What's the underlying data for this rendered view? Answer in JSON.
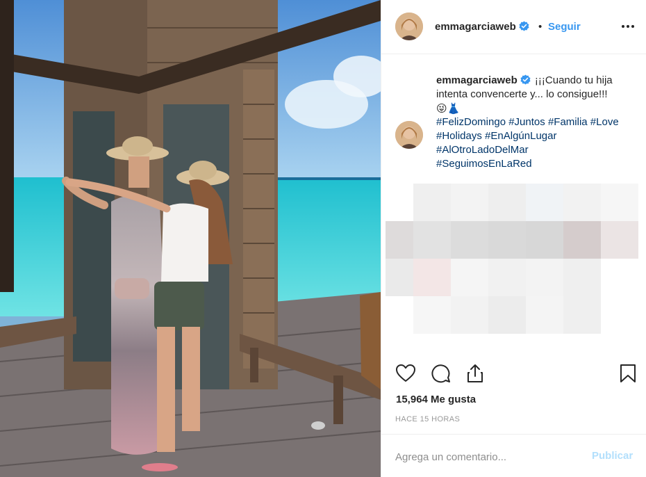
{
  "post": {
    "author": "emmagarciaweb",
    "follow_label": "Seguir",
    "dot": "•",
    "more_icon": "more-horizontal-icon",
    "photo_description_icon": "post-photo",
    "caption_line1": "¡¡¡Cuando tu hija intenta convencerte y... lo consigue!!!",
    "caption_emoji": "😜👗",
    "hashtags": [
      "#FelizDomingo",
      "#Juntos",
      "#Familia",
      "#Love",
      "#Holidays",
      "#EnAlgúnLugar",
      "#AlOtroLadoDelMar",
      "#SeguimosEnLaRed"
    ],
    "likes": "15,964 Me gusta",
    "time": "HACE 15 HORAS",
    "comment_placeholder": "Agrega un comentario...",
    "publish_label": "Publicar"
  },
  "colors": {
    "link": "#3897f0",
    "hashtag": "#003569",
    "publish_disabled": "#b2dffc",
    "muted": "#999999"
  }
}
